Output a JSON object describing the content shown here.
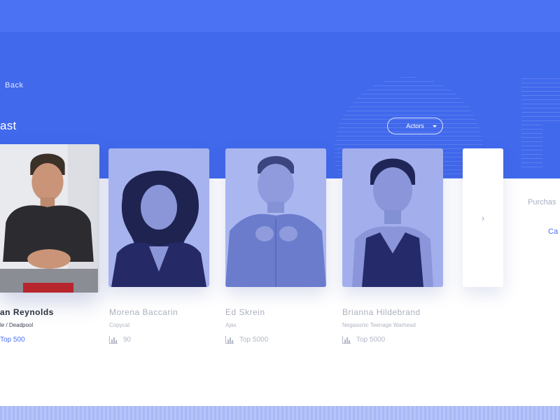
{
  "nav": {
    "back_label": "Back"
  },
  "page": {
    "title": "ast"
  },
  "filter": {
    "label": "Actors"
  },
  "cast": [
    {
      "name": "an Reynolds",
      "role": "le / Deadpool",
      "rank": "Top 500"
    },
    {
      "name": "Morena Baccarin",
      "role": "Copycat",
      "rank": "90"
    },
    {
      "name": "Ed Skrein",
      "role": "Ajax",
      "rank": "Top 5000"
    },
    {
      "name": "Brianna Hildebrand",
      "role": "Negasonic Teenage Warhead",
      "rank": "Top 5000"
    }
  ],
  "side": {
    "label": "Purchas",
    "link": "Ca"
  },
  "icons": {
    "back": "chevron-left-icon",
    "filter_caret": "caret-down-icon",
    "next": "chevron-right-icon",
    "rank": "bar-chart-icon"
  },
  "colors": {
    "brand": "#4169ec",
    "accent": "#4a72f2"
  }
}
